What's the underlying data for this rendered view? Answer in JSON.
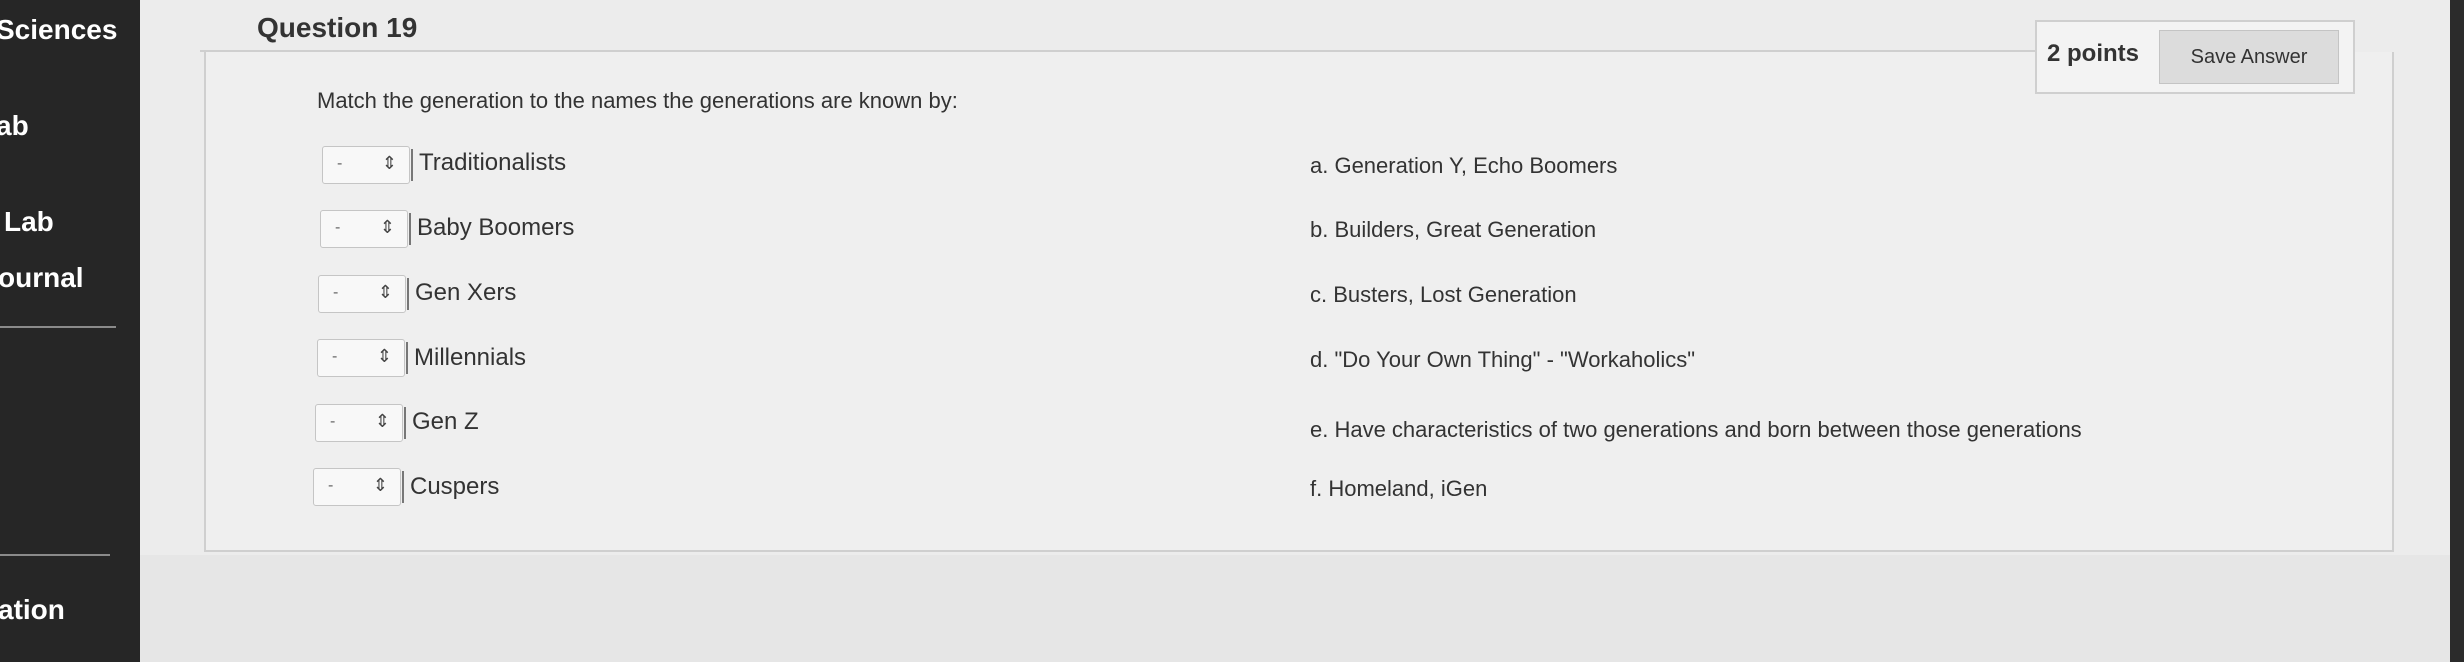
{
  "sidebar": {
    "items": [
      "Sciences",
      "ab",
      "Lab",
      "ournal",
      "ation"
    ]
  },
  "question": {
    "title": "Question 19",
    "points": "2 points",
    "save_label": "Save Answer",
    "prompt": "Match the generation to the names the generations are known by:"
  },
  "terms": [
    {
      "label": "Traditionalists",
      "selected": "-"
    },
    {
      "label": "Baby Boomers",
      "selected": "-"
    },
    {
      "label": "Gen Xers",
      "selected": "-"
    },
    {
      "label": "Millennials",
      "selected": "-"
    },
    {
      "label": "Gen Z",
      "selected": "-"
    },
    {
      "label": "Cuspers",
      "selected": "-"
    }
  ],
  "answers": [
    "a. Generation Y, Echo Boomers",
    "b. Builders, Great Generation",
    "c. Busters, Lost Generation",
    "d. \"Do Your Own Thing\" - \"Workaholics\"",
    "e. Have characteristics of two generations and born between those generations",
    "f. Homeland, iGen"
  ],
  "icons": {
    "select_arrow": "up-down-arrow-icon"
  },
  "colors": {
    "sidebar": "#262626",
    "content": "#ececec",
    "button": "#dcdcdc"
  }
}
